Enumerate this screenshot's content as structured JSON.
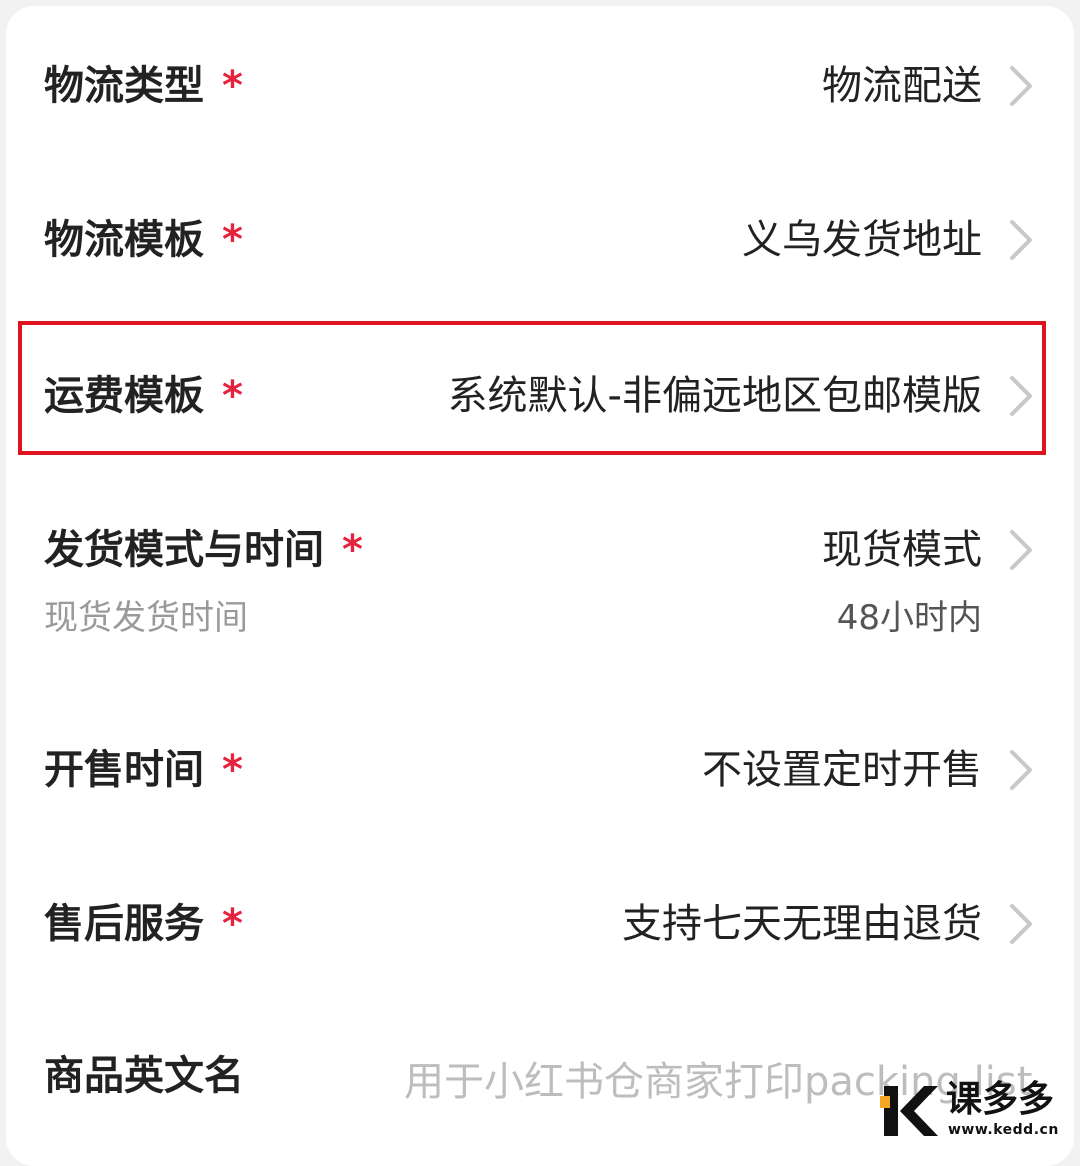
{
  "rows": [
    {
      "label": "物流类型",
      "required": "*",
      "value": "物流配送"
    },
    {
      "label": "物流模板",
      "required": "*",
      "value": "义乌发货地址"
    },
    {
      "label": "运费模板",
      "required": "*",
      "value": "系统默认-非偏远地区包邮模版"
    },
    {
      "label": "发货模式与时间",
      "required": "*",
      "value": "现货模式",
      "sublabel": "现货发货时间",
      "subvalue": "48小时内"
    },
    {
      "label": "开售时间",
      "required": "*",
      "value": "不设置定时开售"
    },
    {
      "label": "售后服务",
      "required": "*",
      "value": "支持七天无理由退货"
    }
  ],
  "english_name": {
    "label": "商品英文名",
    "placeholder": "用于小红书仓商家打印packing list"
  },
  "watermark": {
    "text": "课多多",
    "url": "www.kedd.cn"
  },
  "colors": {
    "required": "#e6223c",
    "highlight_border": "#e0141e",
    "watermark_accent": "#f5a623"
  }
}
